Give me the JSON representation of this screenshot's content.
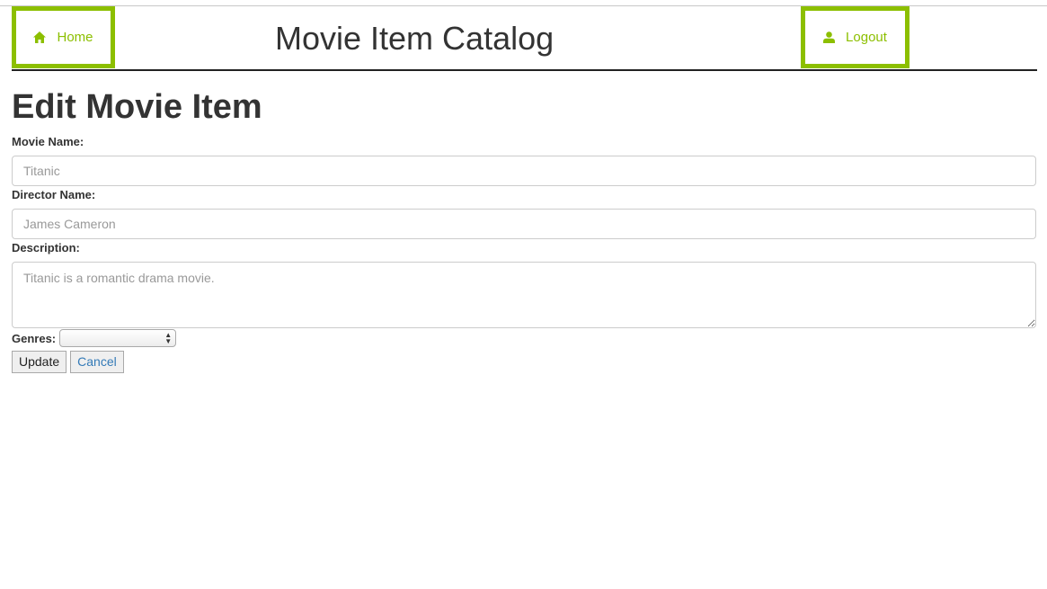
{
  "header": {
    "title": "Movie Item Catalog",
    "home_label": "Home",
    "logout_label": "Logout",
    "home_icon": "home-icon",
    "logout_icon": "user-icon",
    "accent_color": "#8cbf00"
  },
  "form": {
    "heading": "Edit Movie Item",
    "movie_name_label": "Movie Name:",
    "movie_name_placeholder": "Titanic",
    "director_label": "Director Name:",
    "director_placeholder": "James Cameron",
    "description_label": "Description:",
    "description_placeholder": "Titanic is a romantic drama movie.",
    "genres_label": "Genres:",
    "genres_selected": "",
    "update_label": "Update",
    "cancel_label": "Cancel"
  }
}
